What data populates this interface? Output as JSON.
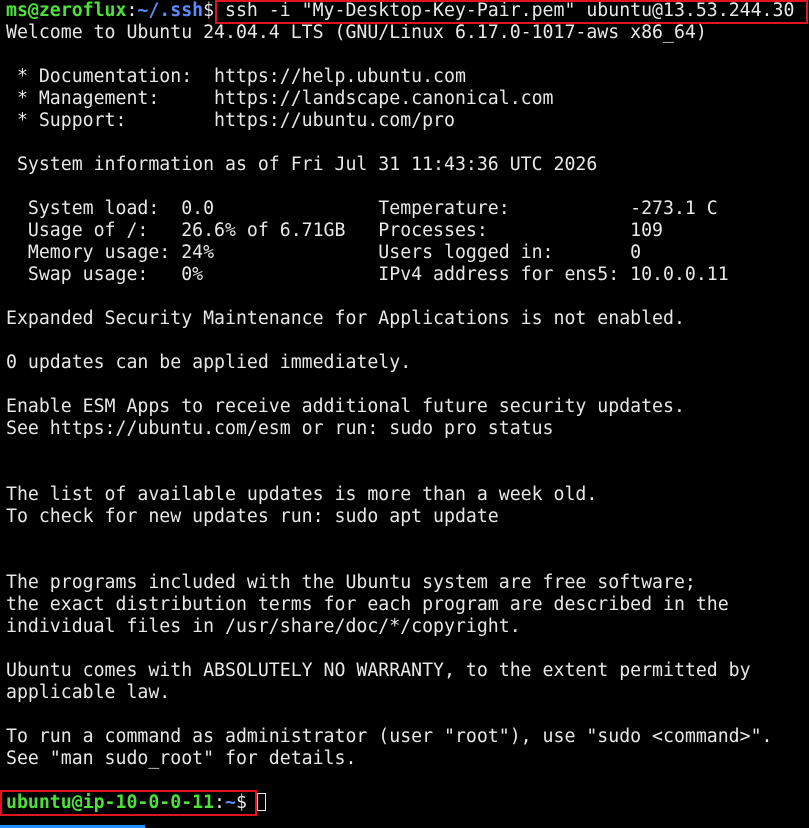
{
  "prompt1": {
    "user_host": "ms@zeroflux",
    "sep": ":",
    "path": "~/.ssh",
    "dollar": "$",
    "command": " ssh -i \"My-Desktop-Key-Pair.pem\" ubuntu@13.53.244.30"
  },
  "motd": {
    "welcome": "Welcome to Ubuntu 24.04.4 LTS (GNU/Linux 6.17.0-1017-aws x86_64)",
    "links": [
      {
        "label": " * Documentation:  ",
        "url": "https://help.ubuntu.com"
      },
      {
        "label": " * Management:     ",
        "url": "https://landscape.canonical.com"
      },
      {
        "label": " * Support:        ",
        "url": "https://ubuntu.com/pro"
      }
    ],
    "sysinfo_header": " System information as of Fri Jul 31 11:43:36 UTC 2026",
    "sysinfo": [
      {
        "left": "  System load:  0.0               ",
        "right": "Temperature:           -273.1 C"
      },
      {
        "left": "  Usage of /:   26.6% of 6.71GB   ",
        "right": "Processes:             109"
      },
      {
        "left": "  Memory usage: 24%               ",
        "right": "Users logged in:       0"
      },
      {
        "left": "  Swap usage:   0%                ",
        "right": "IPv4 address for ens5: 10.0.0.11"
      }
    ],
    "esm_line": "Expanded Security Maintenance for Applications is not enabled.",
    "updates_line": "0 updates can be applied immediately.",
    "esm_apps_1": "Enable ESM Apps to receive additional future security updates.",
    "esm_apps_2": "See https://ubuntu.com/esm or run: sudo pro status",
    "old_list_1": "The list of available updates is more than a week old.",
    "old_list_2": "To check for new updates run: sudo apt update",
    "free_1": "The programs included with the Ubuntu system are free software;",
    "free_2": "the exact distribution terms for each program are described in the",
    "free_3": "individual files in /usr/share/doc/*/copyright.",
    "warranty_1": "Ubuntu comes with ABSOLUTELY NO WARRANTY, to the extent permitted by",
    "warranty_2": "applicable law.",
    "sudo_1": "To run a command as administrator (user \"root\"), use \"sudo <command>\".",
    "sudo_2": "See \"man sudo_root\" for details."
  },
  "prompt2": {
    "user_host": "ubuntu@ip-10-0-0-11",
    "sep": ":",
    "path": "~",
    "dollar": "$"
  },
  "colors": {
    "background": "#000000",
    "text": "#e8e8e8",
    "prompt_green": "#4ee03a",
    "path_blue": "#5e8cff",
    "highlight_red": "#e0141c"
  }
}
